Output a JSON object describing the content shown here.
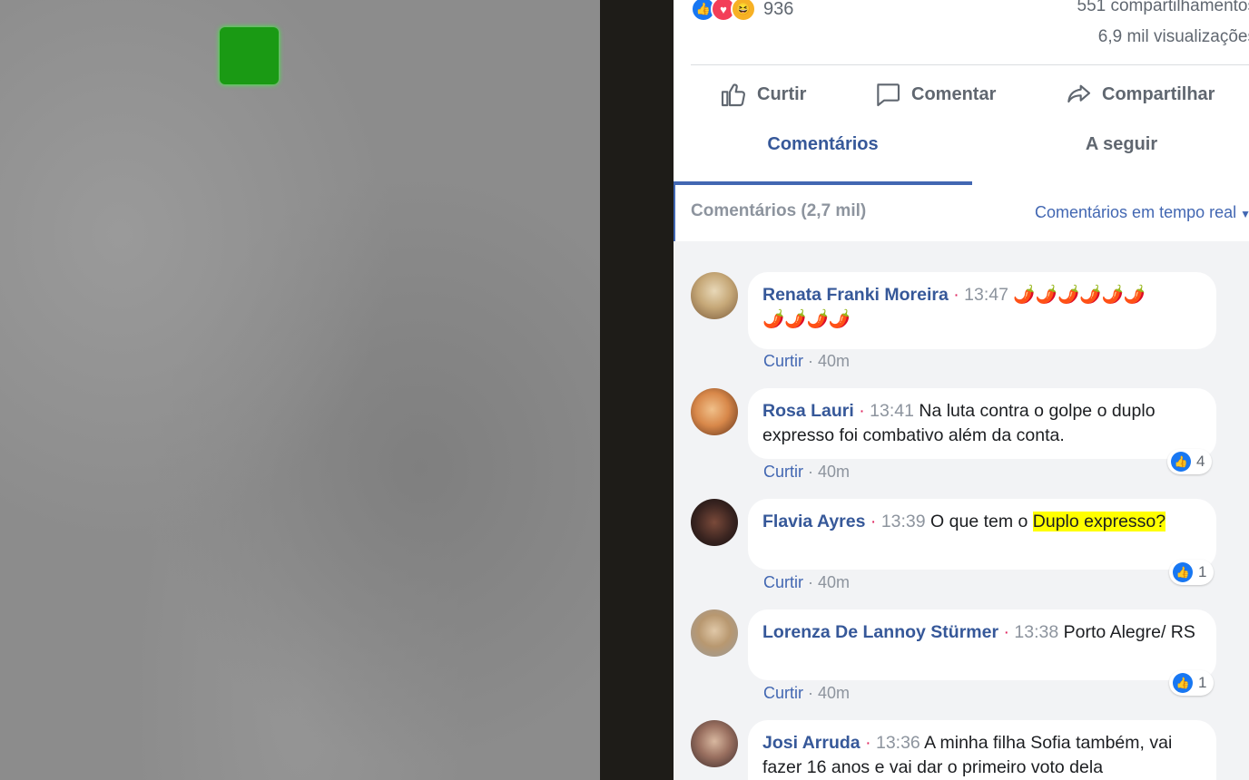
{
  "post": {
    "reaction_count": "936",
    "shares": "551 compartilhamentos",
    "views": "6,9 mil visualizações",
    "actions": {
      "like": "Curtir",
      "comment": "Comentar",
      "share": "Compartilhar"
    },
    "tabs": {
      "comments": "Comentários",
      "following": "A seguir"
    },
    "comments_count": "Comentários (2,7 mil)",
    "comments_filter": "Comentários em tempo real"
  },
  "comments": [
    {
      "name": "Renata Franki Moreira",
      "time": "13:47",
      "text": "",
      "emoji_line1": "🌶️🌶️🌶️🌶️🌶️🌶️",
      "emoji_line2": "🌶️🌶️🌶️🌶️",
      "like_label": "Curtir",
      "age": "40m",
      "likes": ""
    },
    {
      "name": "Rosa Lauri",
      "time": "13:41",
      "text": "Na luta contra o golpe o duplo expresso foi combativo além da conta.",
      "like_label": "Curtir",
      "age": "40m",
      "likes": "4"
    },
    {
      "name": "Flavia Ayres",
      "time": "13:39",
      "text_plain": "O que tem o ",
      "text_highlight": "Duplo expresso?",
      "like_label": "Curtir",
      "age": "40m",
      "likes": "1"
    },
    {
      "name": "Lorenza De Lannoy Stürmer",
      "time": "13:38",
      "text": "Porto Alegre/ RS",
      "like_label": "Curtir",
      "age": "40m",
      "likes": "1"
    },
    {
      "name": "Josi Arruda",
      "time": "13:36",
      "text": "A minha filha Sofia também, vai fazer 16 anos e vai dar o primeiro voto dela",
      "like_label": "",
      "age": "",
      "likes": ""
    }
  ],
  "colors": {
    "link_blue": "#365899",
    "accent_blue": "#4267b2",
    "timestamp_gray": "#8d949e",
    "highlight_yellow": "#ffff00"
  }
}
